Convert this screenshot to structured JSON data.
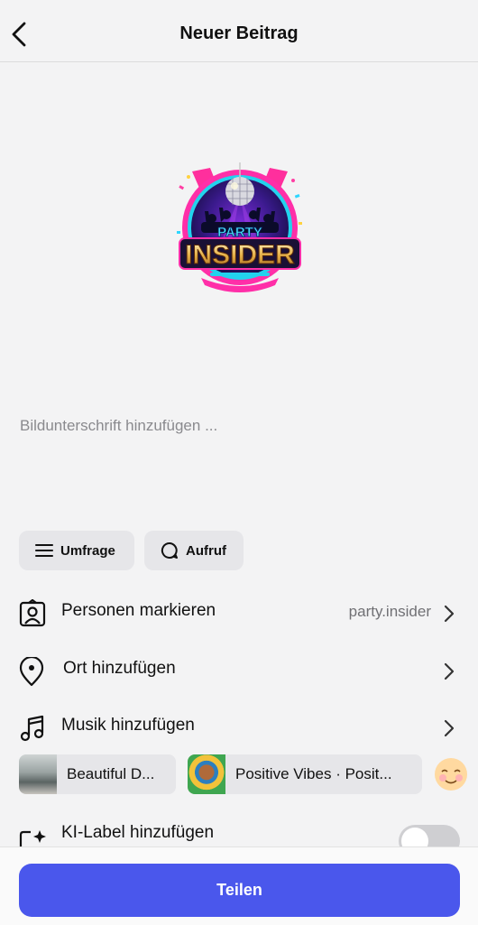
{
  "header": {
    "title": "Neuer Beitrag"
  },
  "logo": {
    "top_text": "PARTY",
    "main_text": "INSIDER"
  },
  "caption": {
    "placeholder": "Bildunterschrift hinzufügen ..."
  },
  "chips": [
    {
      "label": "Umfrage"
    },
    {
      "label": "Aufruf"
    }
  ],
  "rows": {
    "tag_people": {
      "label": "Personen markieren",
      "value": "party.insider"
    },
    "location": {
      "label": "Ort hinzufügen"
    },
    "music": {
      "label": "Musik hinzufügen"
    },
    "ai_label": {
      "label": "KI-Label hinzufügen",
      "enabled": false
    }
  },
  "music_suggestions": [
    {
      "title": "Beautiful D..."
    },
    {
      "title": "Positive Vibes · Posit..."
    }
  ],
  "share_button": {
    "label": "Teilen"
  },
  "colors": {
    "accent": "#4a57ec",
    "background": "#f3f3f4"
  }
}
